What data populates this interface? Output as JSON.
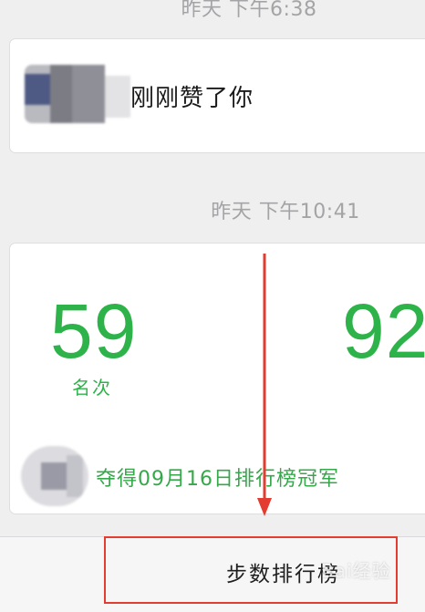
{
  "feed": {
    "timestamps": [
      "昨天 下午6:38",
      "昨天 下午10:41"
    ],
    "like_card": {
      "text": "刚刚赞了你"
    },
    "rank_card": {
      "rank_value": "59",
      "rank_label": "名次",
      "steps_value": "92",
      "champion_text": "夺得09月16日排行榜冠军"
    }
  },
  "bottom_bar": {
    "button_label": "步数排行榜"
  },
  "watermark": "Bai经验",
  "colors": {
    "accent_green": "#2eb34a",
    "annotation_red": "#e33c30",
    "background": "#efeff0"
  }
}
